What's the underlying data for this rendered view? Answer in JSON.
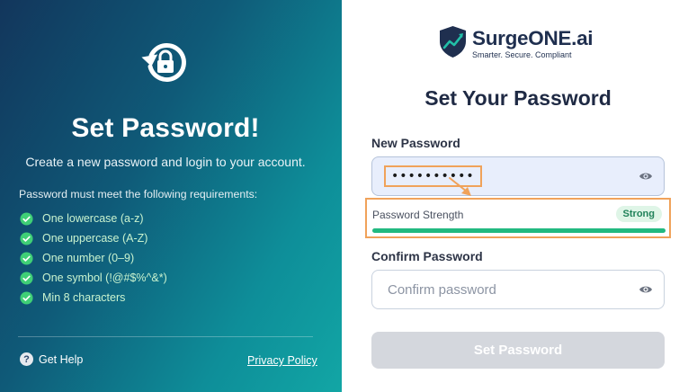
{
  "left_panel": {
    "title": "Set Password!",
    "subtitle": "Create a new password and login to your account.",
    "requirements_heading": "Password must meet the following requirements:",
    "requirements": [
      "One lowercase (a-z)",
      "One uppercase (A-Z)",
      "One number (0–9)",
      "One symbol (!@#$%^&*)",
      "Min 8 characters"
    ],
    "help_label": "Get Help",
    "help_icon": "?",
    "privacy_label": "Privacy Policy"
  },
  "brand": {
    "name": "SurgeONE.ai",
    "tagline": "Smarter. Secure. Compliant"
  },
  "form": {
    "title": "Set Your Password",
    "new_password_label": "New Password",
    "new_password_value": "••••••••••",
    "strength_label": "Password Strength",
    "strength_value": "Strong",
    "strength_fraction": 1.0,
    "confirm_password_label": "Confirm Password",
    "confirm_password_placeholder": "Confirm password",
    "submit_label": "Set Password"
  },
  "colors": {
    "gradient_start": "#12365c",
    "gradient_end": "#12a6a5",
    "check_green": "#3fcf76",
    "strength_green": "#22b980",
    "highlight_orange": "#f0a25a",
    "brand_navy": "#1f2f4f",
    "brand_accent": "#22c0a8"
  },
  "icons": {
    "reset": "lock-rotate-icon",
    "check": "check-circle-icon",
    "help": "question-circle-icon",
    "eye": "eye-icon",
    "logo": "shield-chart-icon"
  }
}
